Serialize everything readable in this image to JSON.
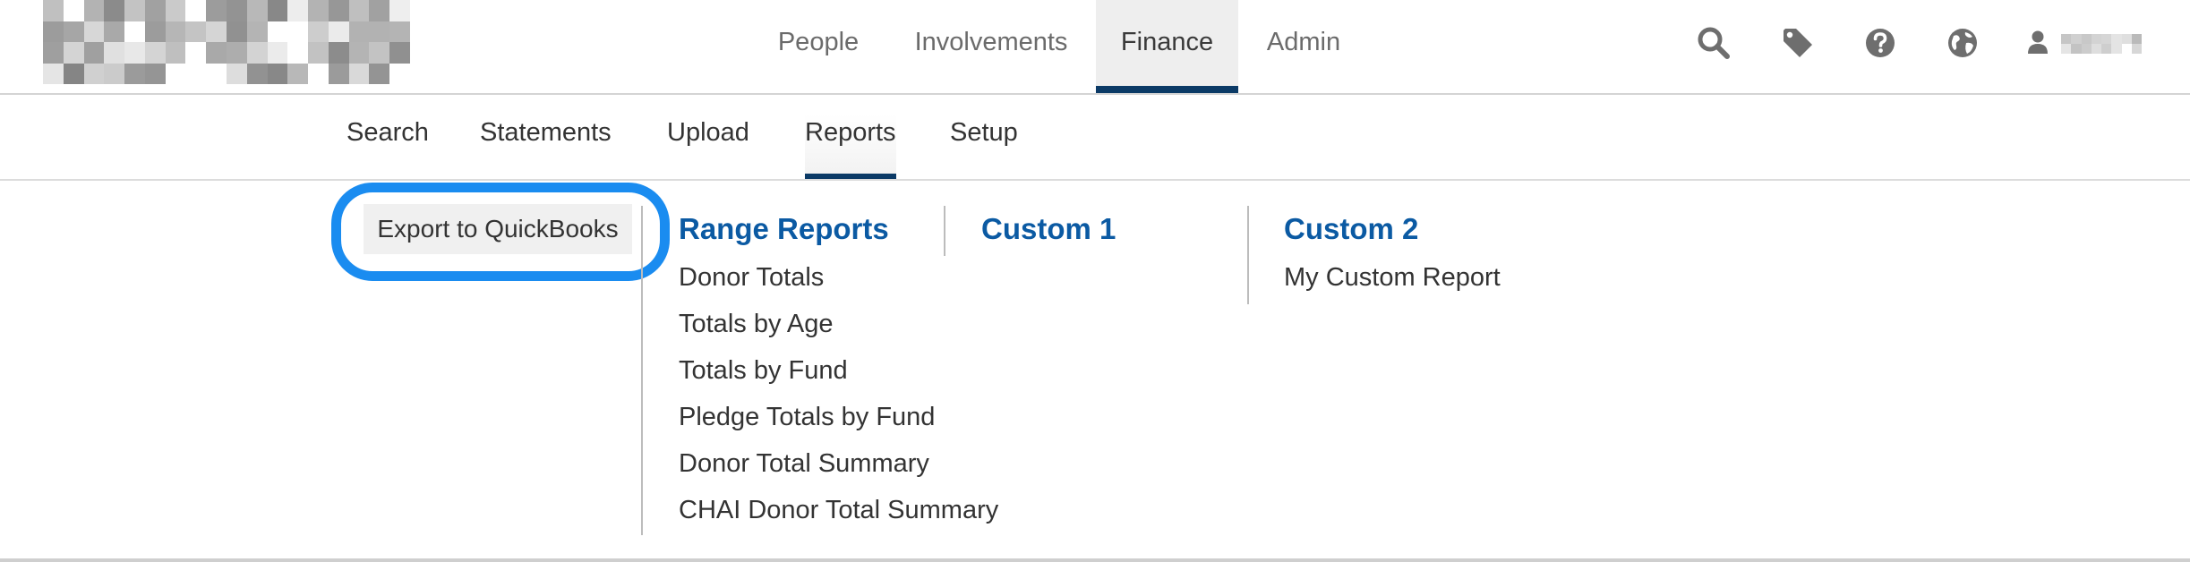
{
  "main_nav": {
    "items": [
      {
        "label": "People"
      },
      {
        "label": "Involvements"
      },
      {
        "label": "Finance"
      },
      {
        "label": "Admin"
      }
    ],
    "active": "Finance"
  },
  "utility_icons": [
    "search-icon",
    "tag-icon",
    "help-icon",
    "globe-icon",
    "user-icon"
  ],
  "sub_nav": {
    "items": [
      {
        "label": "Search"
      },
      {
        "label": "Statements"
      },
      {
        "label": "Upload"
      },
      {
        "label": "Reports"
      },
      {
        "label": "Setup"
      }
    ],
    "active": "Reports"
  },
  "reports_menu": {
    "export_button": "Export to QuickBooks",
    "columns": [
      {
        "title": "Range Reports",
        "links": [
          "Donor Totals",
          "Totals by Age",
          "Totals by Fund",
          "Pledge Totals by Fund",
          "Donor Total Summary",
          "CHAI Donor Total Summary"
        ]
      },
      {
        "title": "Custom 1",
        "links": []
      },
      {
        "title": "Custom 2",
        "links": [
          "My Custom Report"
        ]
      }
    ]
  },
  "colors": {
    "accent_navy": "#0b3a66",
    "link_blue": "#0b5aa3",
    "highlight_ring": "#1a8cf0",
    "nav_text": "#6b6b6b"
  }
}
